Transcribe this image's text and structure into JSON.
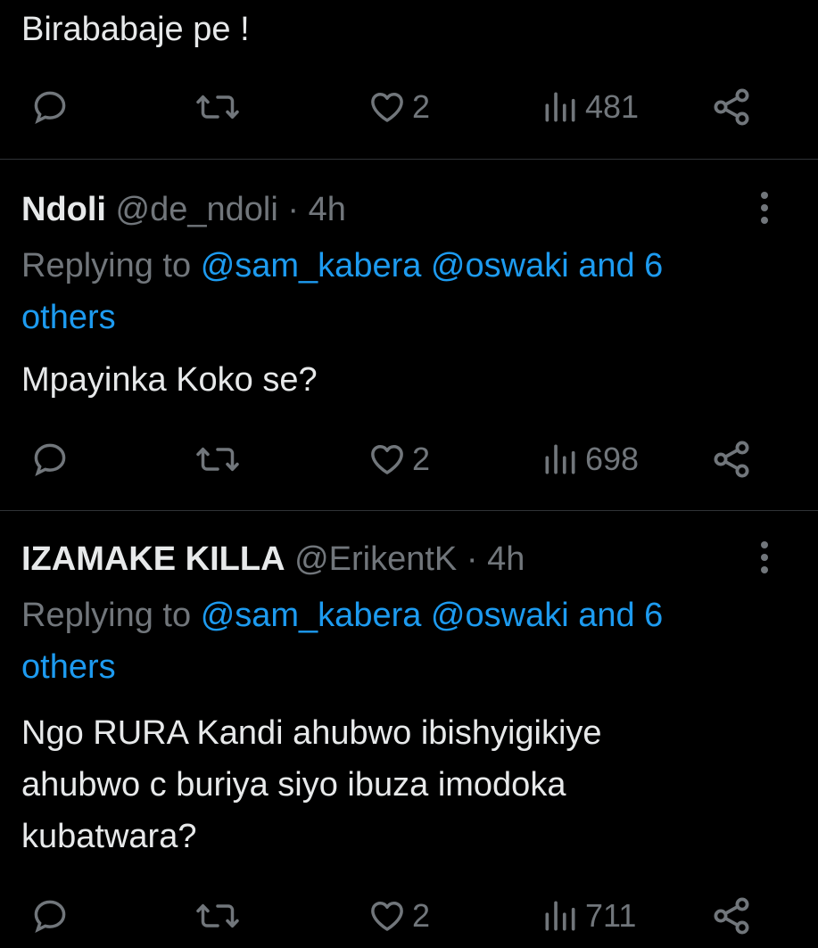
{
  "tweets": [
    {
      "text": "Birababaje pe !",
      "actions": {
        "likes": "2",
        "views": "481"
      }
    },
    {
      "author": "Ndoli",
      "handle": "@de_ndoli",
      "time": "· 4h",
      "replying_prefix": "Replying to",
      "replying_mentions": "@sam_kabera @oswaki and 6",
      "replying_others": "others",
      "text": "Mpayinka Koko se?",
      "actions": {
        "likes": "2",
        "views": "698"
      }
    },
    {
      "author": "IZAMAKE KILLA",
      "handle": "@ErikentK",
      "time": "· 4h",
      "replying_prefix": "Replying to",
      "replying_mentions": "@sam_kabera @oswaki and 6",
      "replying_others": "others",
      "text_lines": [
        "Ngo RURA Kandi ahubwo ibishyigikiye",
        "ahubwo c buriya siyo ibuza imodoka",
        "kubatwara?"
      ],
      "actions": {
        "likes": "2",
        "views": "711"
      }
    }
  ],
  "colors": {
    "background": "#000000",
    "text": "#e7e9ea",
    "muted": "#71767b",
    "link": "#1d9bf0",
    "divider": "#2f3336"
  },
  "icons": [
    "reply-icon",
    "retweet-icon",
    "like-icon",
    "views-icon",
    "share-icon",
    "more-icon"
  ]
}
